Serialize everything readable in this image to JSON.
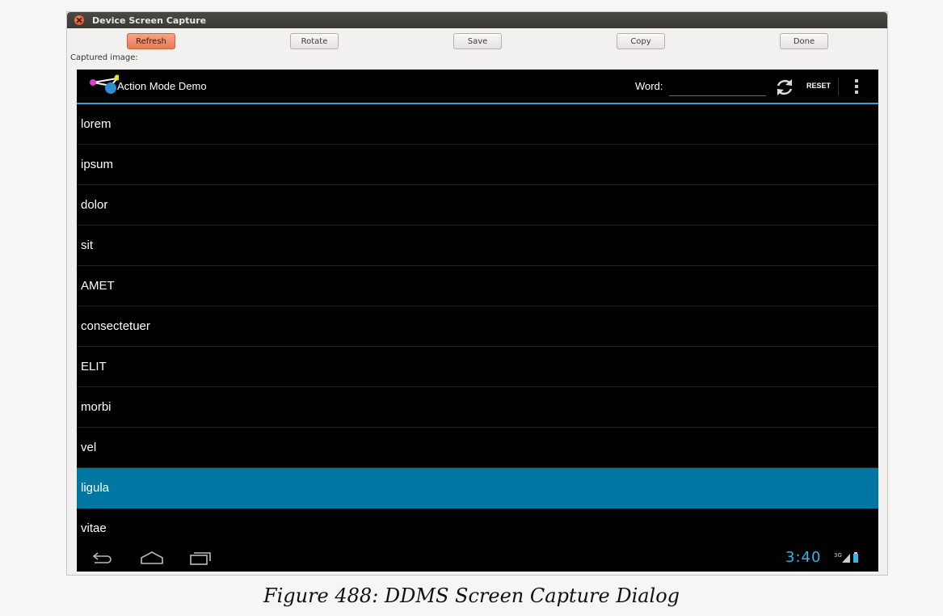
{
  "window": {
    "title": "Device Screen Capture"
  },
  "toolbar": {
    "refresh": "Refresh",
    "rotate": "Rotate",
    "save": "Save",
    "copy": "Copy",
    "done": "Done"
  },
  "captured_label": "Captured image:",
  "device": {
    "app_title": "Action Mode Demo",
    "word_label": "Word:",
    "word_value": "",
    "reset_label": "RESET",
    "accent_color": "#33b5e5",
    "selected_color": "#0077a3",
    "list_items": [
      "lorem",
      "ipsum",
      "dolor",
      "sit",
      "AMET",
      "consectetuer",
      "ELIT",
      "morbi",
      "vel",
      "ligula",
      "vitae"
    ],
    "selected_item": "ligula",
    "clock": "3:40",
    "network": "3G"
  },
  "figure_caption": "Figure 488: DDMS Screen Capture Dialog"
}
